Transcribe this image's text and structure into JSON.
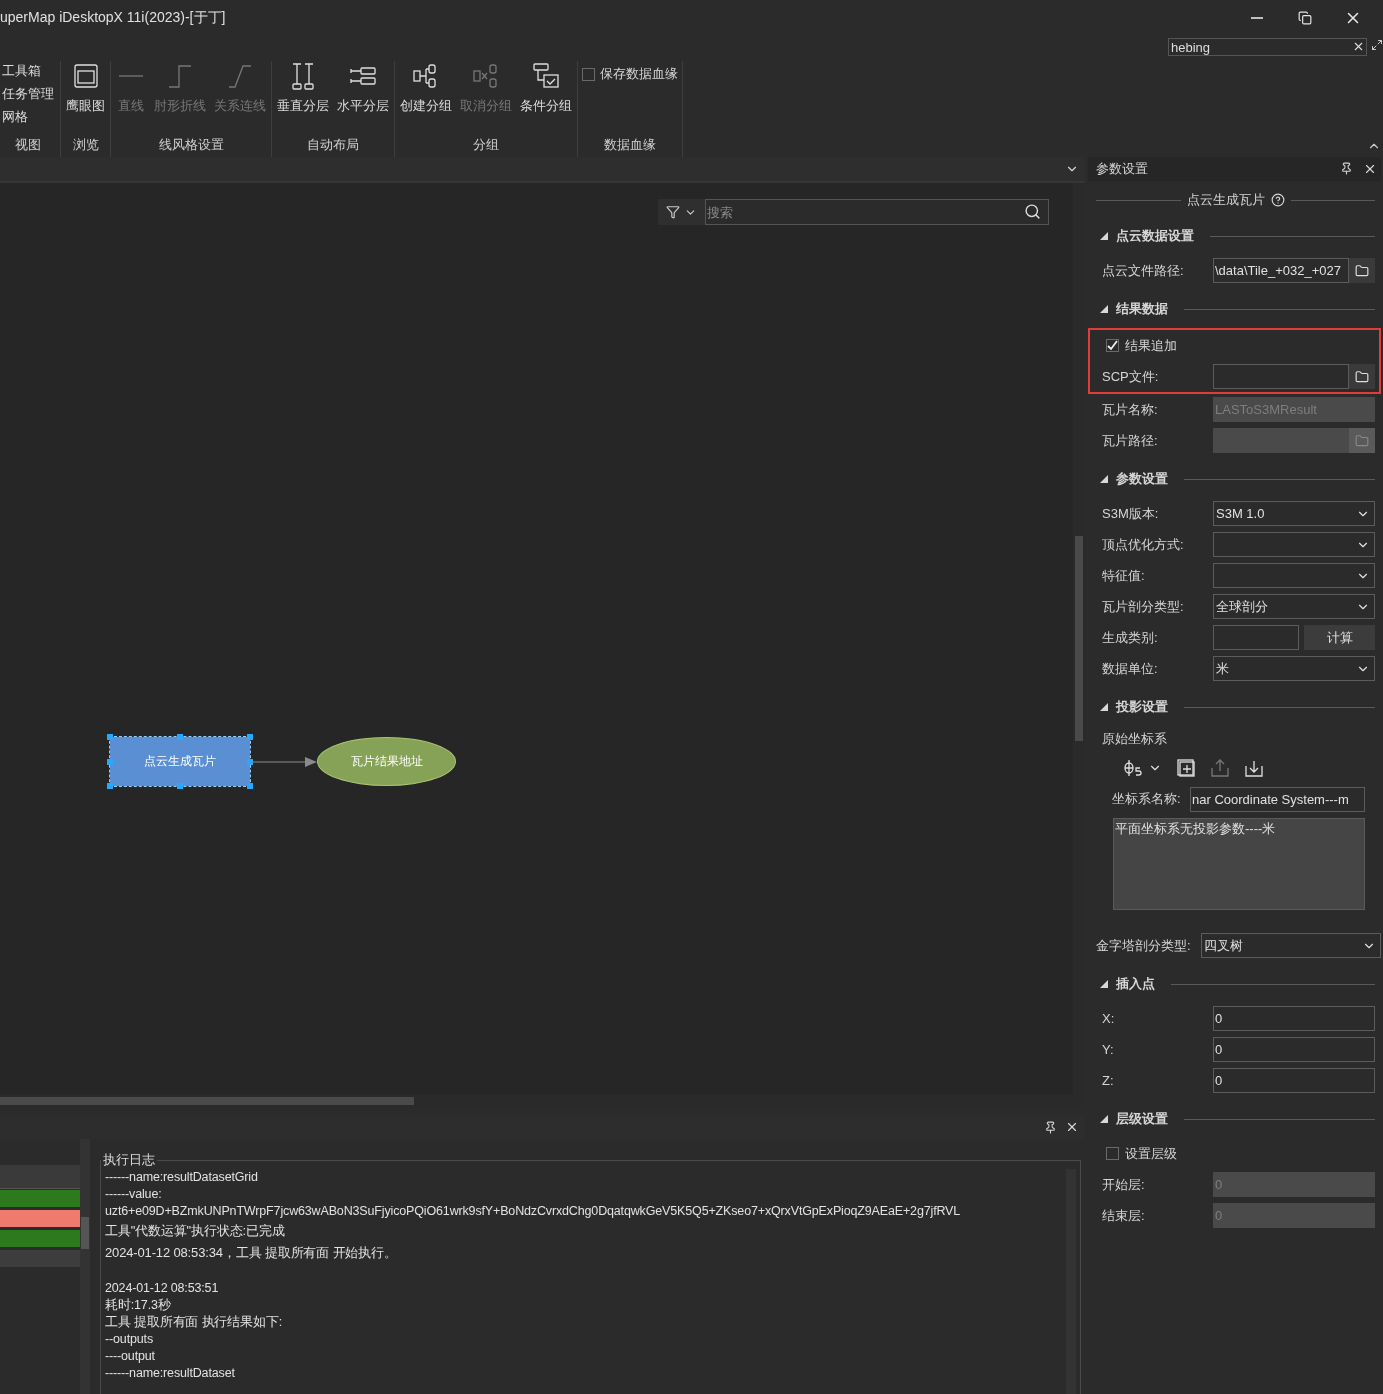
{
  "window": {
    "title": "uperMap iDesktopX 11i(2023)-[于丁]"
  },
  "quick_search": {
    "value": "hebing"
  },
  "ribbon": {
    "groups": [
      {
        "label": "视图",
        "kind": "links",
        "items": [
          {
            "label": "工具箱",
            "disabled": false
          },
          {
            "label": "任务管理",
            "disabled": false
          },
          {
            "label": "网格",
            "disabled": false
          }
        ]
      },
      {
        "label": "浏览",
        "kind": "buttons",
        "items": [
          {
            "label": "鹰眼图",
            "disabled": false
          }
        ]
      },
      {
        "label": "线风格设置",
        "kind": "buttons",
        "items": [
          {
            "label": "直线",
            "disabled": true
          },
          {
            "label": "肘形折线",
            "disabled": true
          },
          {
            "label": "关系连线",
            "disabled": true
          }
        ]
      },
      {
        "label": "自动布局",
        "kind": "buttons",
        "items": [
          {
            "label": "垂直分层",
            "disabled": false
          },
          {
            "label": "水平分层",
            "disabled": false
          }
        ]
      },
      {
        "label": "分组",
        "kind": "buttons",
        "items": [
          {
            "label": "创建分组",
            "disabled": false
          },
          {
            "label": "取消分组",
            "disabled": true
          },
          {
            "label": "条件分组",
            "disabled": false
          }
        ]
      },
      {
        "label": "数据血缘",
        "kind": "checks",
        "items": [
          {
            "label": "保存数据血缘",
            "checked": false
          }
        ]
      }
    ]
  },
  "canvas": {
    "search": {
      "placeholder": "搜索"
    },
    "nodes": [
      {
        "kind": "process",
        "label": "点云生成瓦片",
        "selected": true
      },
      {
        "kind": "output",
        "label": "瓦片结果地址",
        "selected": false
      }
    ]
  },
  "log_panel": {
    "status_rows": [
      {
        "color": "#2d7a1e"
      },
      {
        "color": "#ef7b6e"
      },
      {
        "color": "#2d7a1e"
      },
      {
        "color": "#3d3d3d"
      }
    ],
    "title": "执行日志",
    "lines": [
      {
        "kind": "detail",
        "text": "------name:resultDatasetGrid"
      },
      {
        "kind": "detail",
        "text": "------value:"
      },
      {
        "kind": "detail",
        "text": "uzt6+e09D+BZmkUNPnTWrpF7jcw63wABoN3SuFjyicoPQiO61wrk9sfY+BoNdzCvrxdChg0DqatqwkGeV5K5Q5+ZKseo7+xQrxVtGpExPioqZ9AEaE+2g7jfRVL"
      },
      {
        "kind": "status",
        "text": "工具\"代数运算\"执行状态:已完成"
      },
      {
        "kind": "status",
        "text": "2024-01-12 08:53:34，工具 提取所有面 开始执行。"
      },
      {
        "kind": "stamp",
        "text": "2024-01-12 08:53:51"
      },
      {
        "kind": "detail",
        "text": "耗时:17.3秒"
      },
      {
        "kind": "detail",
        "text": "工具 提取所有面 执行结果如下:"
      },
      {
        "kind": "detail",
        "text": "--outputs"
      },
      {
        "kind": "detail",
        "text": "----output"
      },
      {
        "kind": "detail",
        "text": "------name:resultDataset"
      }
    ]
  },
  "params_panel": {
    "title": "参数设置",
    "tool": "点云生成瓦片",
    "items": [
      {
        "kind": "section",
        "title": "点云数据设置",
        "rows": [
          {
            "kind": "file",
            "label": "点云文件路径:",
            "value": "\\data\\Tile_+032_+027",
            "disabled": false
          }
        ]
      },
      {
        "kind": "section",
        "title": "结果数据",
        "rows": [
          {
            "kind": "group",
            "highlighted": true,
            "rows": [
              {
                "kind": "check",
                "label": "结果追加",
                "checked": true
              },
              {
                "kind": "file",
                "label": "SCP文件:",
                "value": "",
                "disabled": false
              }
            ]
          },
          {
            "kind": "text",
            "label": "瓦片名称:",
            "value": "LASToS3MResult",
            "disabled": true
          },
          {
            "kind": "file",
            "label": "瓦片路径:",
            "value": "",
            "disabled": true
          }
        ]
      },
      {
        "kind": "section",
        "title": "参数设置",
        "rows": [
          {
            "kind": "select",
            "label": "S3M版本:",
            "value": "S3M 1.0"
          },
          {
            "kind": "select",
            "label": "顶点优化方式:",
            "value": ""
          },
          {
            "kind": "select",
            "label": "特征值:",
            "value": ""
          },
          {
            "kind": "select",
            "label": "瓦片剖分类型:",
            "value": "全球剖分"
          },
          {
            "kind": "compute",
            "label": "生成类别:",
            "value": "",
            "button": "计算"
          },
          {
            "kind": "select",
            "label": "数据单位:",
            "value": "米"
          }
        ]
      },
      {
        "kind": "section",
        "title": "投影设置",
        "rows": [
          {
            "kind": "caption",
            "label": "原始坐标系"
          },
          {
            "kind": "tools",
            "tools": [
              {
                "disabled": false
              },
              {
                "disabled": false
              },
              {
                "disabled": true
              },
              {
                "disabled": false
              }
            ]
          },
          {
            "kind": "coord",
            "label": "坐标系名称:",
            "value": "nar Coordinate System---m"
          },
          {
            "kind": "memo",
            "value": "平面坐标系无投影参数----米"
          }
        ]
      },
      {
        "kind": "select",
        "label": "金字塔剖分类型:",
        "value": "四叉树"
      },
      {
        "kind": "section",
        "title": "插入点",
        "rows": [
          {
            "kind": "text",
            "label": "X:",
            "value": "0",
            "disabled": false
          },
          {
            "kind": "text",
            "label": "Y:",
            "value": "0",
            "disabled": false
          },
          {
            "kind": "text",
            "label": "Z:",
            "value": "0",
            "disabled": false
          }
        ]
      },
      {
        "kind": "section",
        "title": "层级设置",
        "rows": [
          {
            "kind": "check",
            "label": "设置层级",
            "checked": false
          },
          {
            "kind": "text",
            "label": "开始层:",
            "value": "0",
            "disabled": true
          },
          {
            "kind": "text",
            "label": "结束层:",
            "value": "0",
            "disabled": true
          }
        ]
      }
    ]
  }
}
